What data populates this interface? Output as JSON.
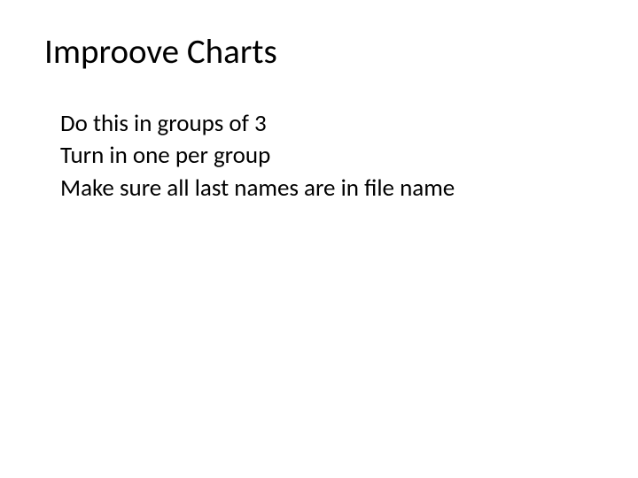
{
  "slide": {
    "title": "Improove Charts",
    "lines": [
      "Do this in groups of 3",
      "Turn in one per group",
      "Make sure all last names are in file name"
    ]
  }
}
